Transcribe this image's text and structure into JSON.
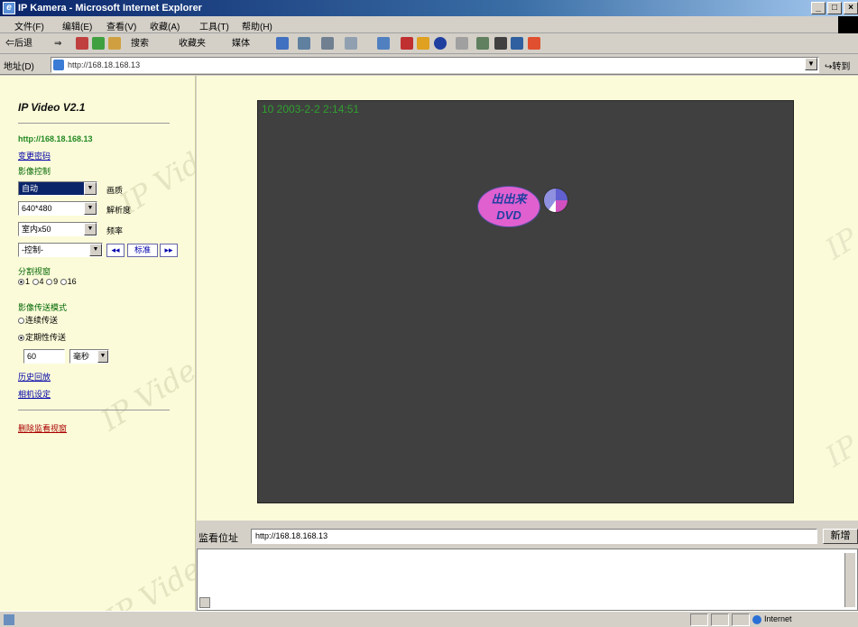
{
  "window": {
    "title": "IP Kamera - Microsoft Internet Explorer",
    "buttons": [
      "_",
      "□",
      "×"
    ]
  },
  "menubar": [
    "文件(F)",
    "编辑(E)",
    "查看(V)",
    "收藏(A)",
    "工具(T)",
    "帮助(H)"
  ],
  "toolbar": {
    "back": "⇐后退",
    "forward": "⇒",
    "search": "搜索",
    "favorites": "收藏夹",
    "media": "媒体"
  },
  "address": {
    "label": "地址(D)",
    "url": "http://168.18.168.13",
    "go": "转到"
  },
  "sidebar": {
    "title": "IP Video V2.1",
    "host": "http://168.18.168.13",
    "link_top": "变更密码",
    "image_control_label": "影像控制",
    "selects": [
      {
        "value": "自动",
        "label": "画质",
        "highlighted": true
      },
      {
        "value": "640*480",
        "label": "解析度"
      },
      {
        "value": "室内x50",
        "label": "频率"
      },
      {
        "value": "-控制-",
        "label": ""
      }
    ],
    "nav_buttons": {
      "prev": "◂◂",
      "center": "标准",
      "next": "▸▸"
    },
    "split_label": "分割视窗",
    "split_options": [
      "1",
      "4",
      "9",
      "16"
    ],
    "split_selected": "1",
    "transfer_label": "影像传送模式",
    "transfer_options": [
      "连续传送",
      "定期性传送"
    ],
    "transfer_selected": "定期性传送",
    "interval_value": "60",
    "interval_unit": "毫秒",
    "links": [
      "历史回放",
      "相机设定"
    ],
    "delete_link": "删除监看视窗",
    "watermark": "IP Video"
  },
  "video": {
    "timestamp": "10  2003-2-2   2:14:51",
    "logo_line1": "出出来",
    "logo_line2": "DVD"
  },
  "bottom": {
    "label": "监看位址",
    "url_value": "http://168.18.168.13",
    "add_button": "新增"
  },
  "statusbar": {
    "zone": "Internet"
  }
}
